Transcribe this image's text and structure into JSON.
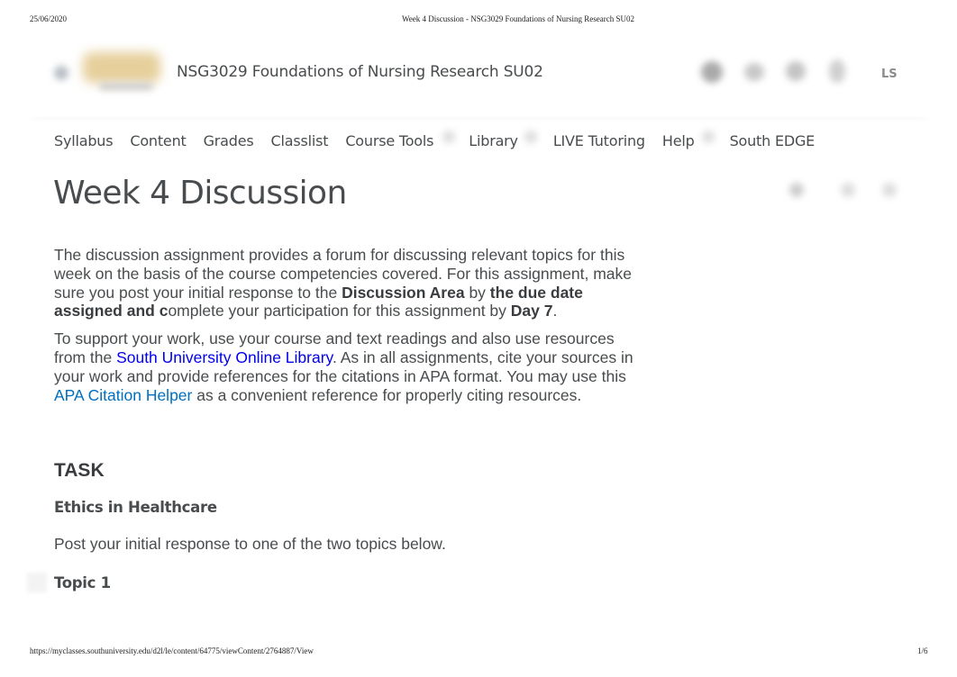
{
  "print": {
    "date": "25/06/2020",
    "doc_title": "Week 4 Discussion - NSG3029 Foundations of Nursing Research SU02",
    "url": "https://myclasses.southuniversity.edu/d2l/le/content/64775/viewContent/2764887/View",
    "page": "1/6"
  },
  "navbar": {
    "course_title": "NSG3029 Foundations of Nursing Research SU02",
    "user_initials": "LS",
    "icons": [
      "grid-icon",
      "message-icon",
      "chat-icon",
      "notification-icon"
    ]
  },
  "tabs": [
    {
      "label": "Syllabus",
      "has_dropdown": false
    },
    {
      "label": "Content",
      "has_dropdown": false
    },
    {
      "label": "Grades",
      "has_dropdown": false
    },
    {
      "label": "Classlist",
      "has_dropdown": false
    },
    {
      "label": "Course Tools",
      "has_dropdown": true
    },
    {
      "label": "Library",
      "has_dropdown": true
    },
    {
      "label": "LIVE Tutoring",
      "has_dropdown": false
    },
    {
      "label": "Help",
      "has_dropdown": true
    },
    {
      "label": "South EDGE",
      "has_dropdown": false
    }
  ],
  "page": {
    "title": "Week 4 Discussion",
    "para1": {
      "t1": "The discussion assignment provides a forum for discussing relevant topics for this week on the basis of the course competencies covered. For this assignment, make sure you post your initial response to the ",
      "b1": "Discussion Area",
      "t2": " by ",
      "b2": "the due date assigned and c",
      "t3": "omplete your participation for this assignment by ",
      "b3": "Day 7",
      "t4": "."
    },
    "para2": {
      "t1": "To support your work, use your course and text readings and also use resources from the ",
      "link1": "South University Online Library",
      "t2": ". As in all assignments, cite your sources in your work and provide references for the citations in APA format. You may use this ",
      "link2": "APA Citation Helper",
      "t3": " as a convenient reference for properly citing resources."
    },
    "task_heading": "TASK",
    "section_heading": "Ethics in Healthcare",
    "instruction": "Post your initial response to one of the two topics below.",
    "topic_heading": "Topic 1"
  },
  "colors": {
    "text": "#494c4e",
    "link_visited": "#0000ee",
    "link": "#006fbf",
    "logo_gold": "#e6cf9b"
  }
}
